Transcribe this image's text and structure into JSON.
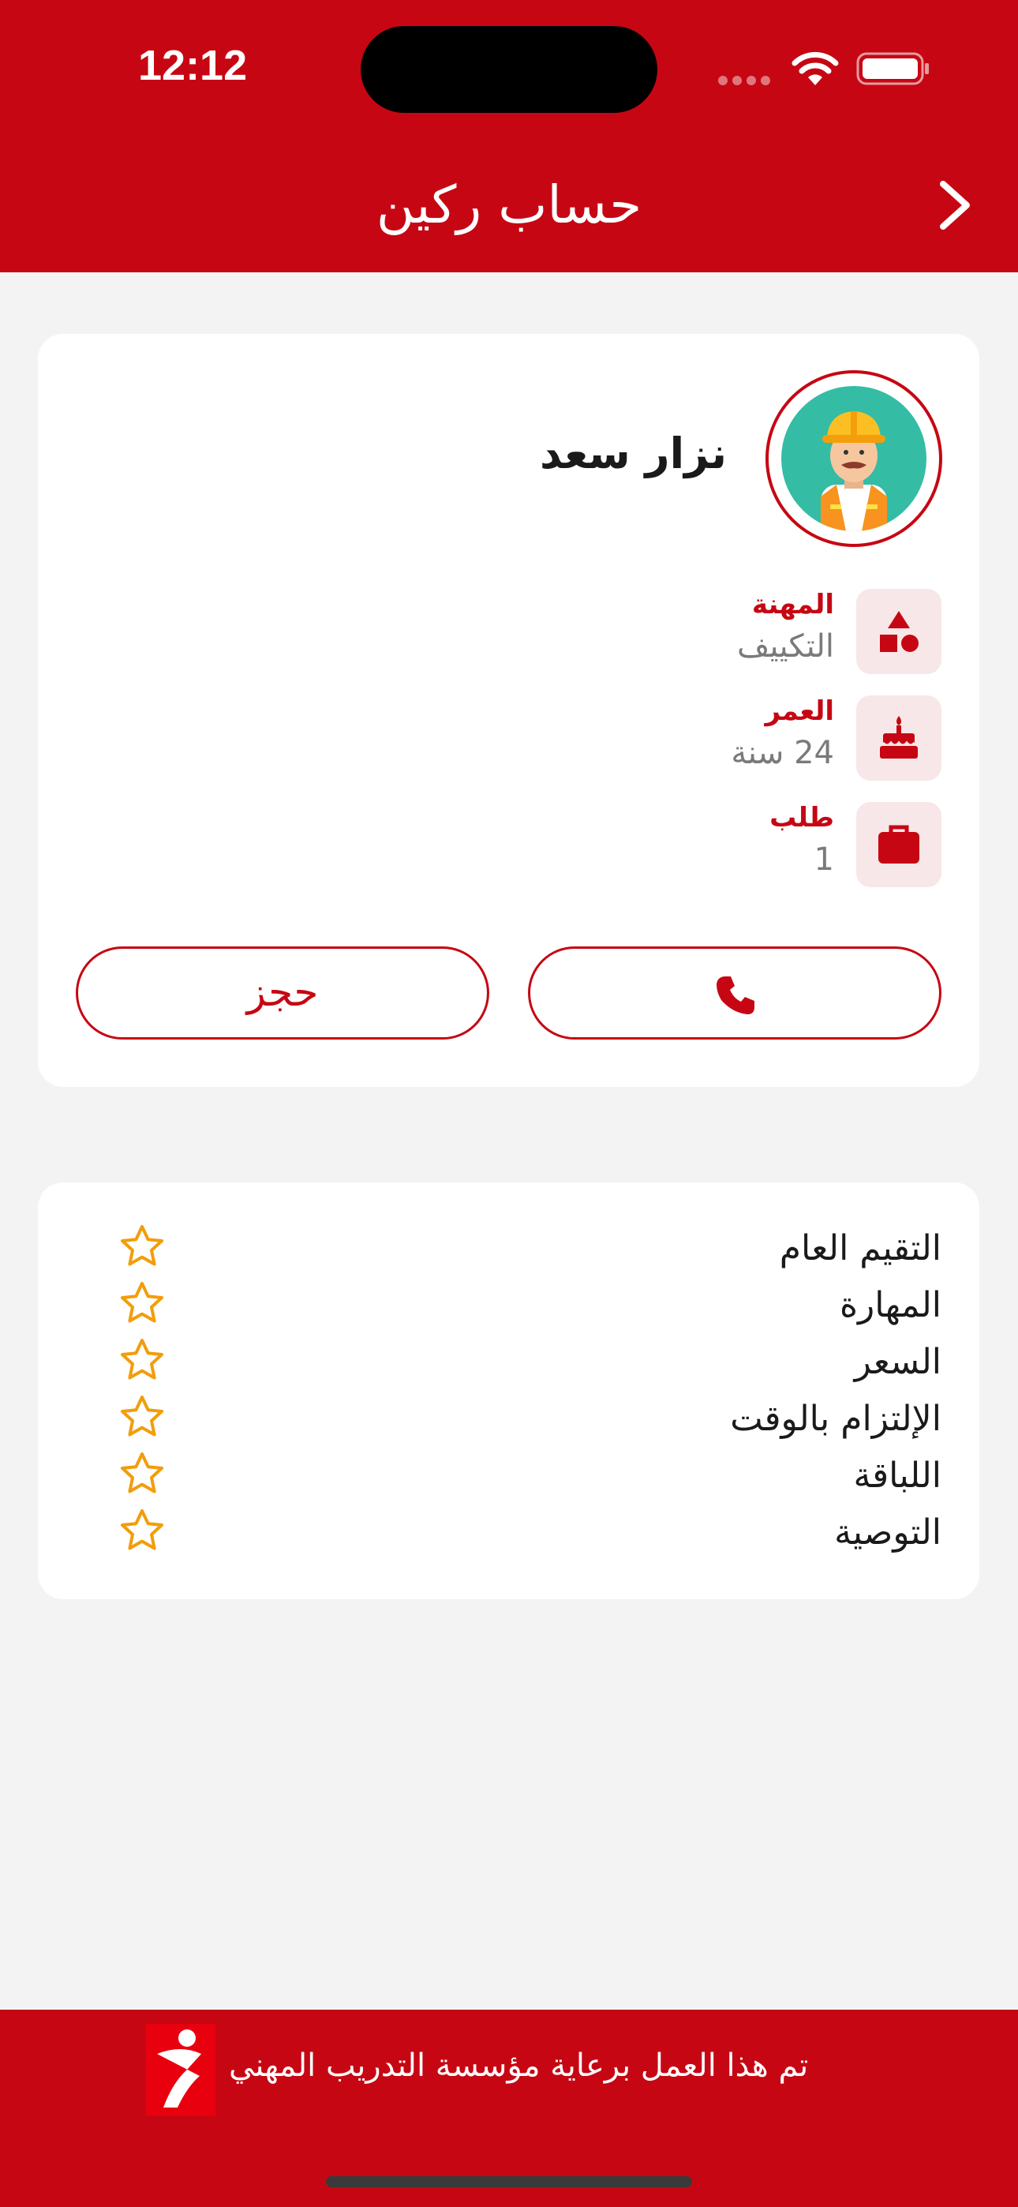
{
  "status_bar": {
    "time": "12:12"
  },
  "header": {
    "title": "حساب ركين"
  },
  "profile": {
    "name": "نزار سعد",
    "info": [
      {
        "label": "المهنة",
        "value": "التكييف",
        "icon": "shapes-icon"
      },
      {
        "label": "العمر",
        "value": "24 سنة",
        "icon": "cake-icon"
      },
      {
        "label": "طلب",
        "value": "1",
        "icon": "briefcase-icon"
      }
    ],
    "call_icon": "phone-icon",
    "book_label": "حجز"
  },
  "ratings": [
    {
      "label": "التقيم العام",
      "stars": 0
    },
    {
      "label": "المهارة",
      "stars": 0
    },
    {
      "label": "السعر",
      "stars": 0
    },
    {
      "label": "الإلتزام بالوقت",
      "stars": 0
    },
    {
      "label": "اللباقة",
      "stars": 0
    },
    {
      "label": "التوصية",
      "stars": 0
    }
  ],
  "footer": {
    "text": "تم هذا العمل برعاية مؤسسة التدريب المهني"
  },
  "colors": {
    "brand": "#c60713",
    "star": "#f29d0a",
    "avatar_bg": "#35bca5"
  }
}
